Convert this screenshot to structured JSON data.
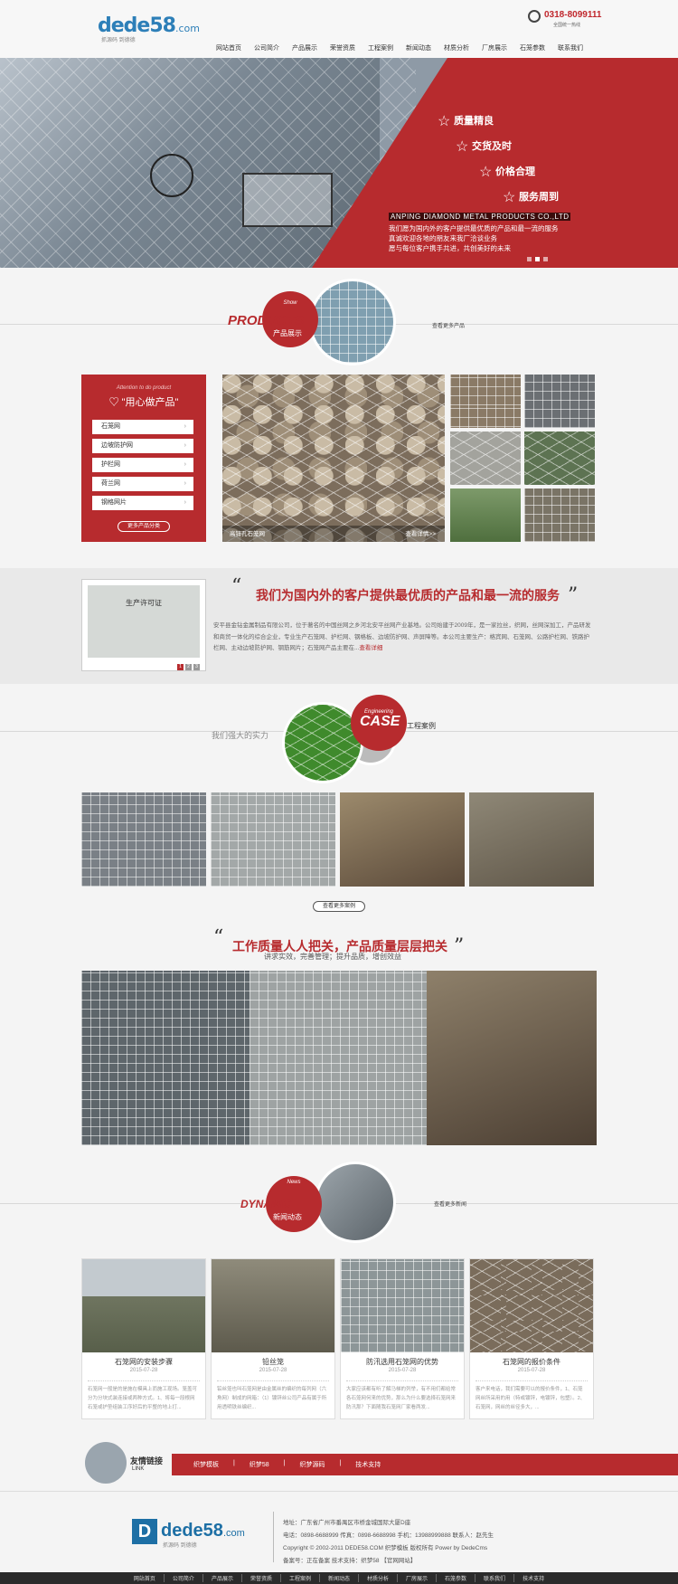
{
  "header": {
    "logo_main": "dede58",
    "logo_suffix": ".com",
    "logo_slogan": "抓源码  到德德",
    "phone": "0318-8099111",
    "phone_label": "全国统一热线"
  },
  "nav": [
    "网站首页",
    "公司简介",
    "产品展示",
    "荣誉资质",
    "工程案例",
    "新闻动态",
    "材质分析",
    "厂房展示",
    "石笼参数",
    "联系我们"
  ],
  "banner": {
    "features": [
      "质量精良",
      "交货及时",
      "价格合理",
      "服务周到"
    ],
    "company_en": "ANPING DIAMOND METAL PRODUCTS CO.,LTD",
    "text1": "我们愿为国内外的客户提供最优质的产品和最一流的服务",
    "text2": "真诚欢迎各地的朋友来我厂洽谈业务",
    "text3": "愿与每位客户携手共进，共创美好的未来",
    "slides": [
      1,
      2,
      3
    ]
  },
  "products": {
    "en": "PRODUCTS",
    "cn": "产品展示",
    "tag": "Show",
    "more": "查看更多产品",
    "side_en": "Attention to do product",
    "side_title": "\"用心做产品\"",
    "items": [
      "石笼网",
      "边坡防护网",
      "护栏网",
      "荷兰网",
      "钢格网片"
    ],
    "side_more": "更多产品分类",
    "main_caption": "高锌孔石笼网",
    "main_more": "查看详情>>"
  },
  "about": {
    "quote_open": "“",
    "quote_close": "”",
    "heading": "我们为国内外的客户提供最优质的产品和最一流的服务",
    "text": "安平县金钻金属制品有限公司，位于著名的中国丝网之乡河北安平丝网产业基地。公司始建于2009年，是一家拉丝，织网，丝网深加工，产品研发和商贸一体化的综合企业，专业生产石笼网、护栏网、钢格板、边坡防护网、声屏障等。本公司主要生产：格宾网、石笼网、公路护栏网、铁路护栏网、主动边坡防护网、钢筋网片；石笼网产品主要在...",
    "more": "查看详细",
    "cert_title": "生产许可证",
    "pages": [
      "1",
      "2",
      "3"
    ]
  },
  "cases": {
    "left_text": "我们强大的实力",
    "en": "CASE",
    "tag": "Engineering",
    "cn": "工程案例",
    "more": "查看更多案例"
  },
  "quality": {
    "heading": "工作质量人人把关，产品质量层层把关",
    "sub": "讲求实效，完善管理；提升品质，增创效益"
  },
  "news": {
    "en": "DYNAMIC",
    "tag": "News",
    "cn": "新闻动态",
    "more": "查看更多新闻",
    "items": [
      {
        "title": "石笼网的安装步骤",
        "date": "2015-07-28",
        "text": "石笼网一般是的是施在模具上而施工现场。笼盖可分为分块式装连接或两种方式。1、将每一段根网石笼或护垫组装工序好后的平整的地上打..."
      },
      {
        "title": "铅丝笼",
        "date": "2015-07-28",
        "text": "铅丝笼也叫石笼网是由金属丝的编织的每列网（六角网）制成的网箱：（1）镀锌丝公司产品有属于所用透明铁丝编织..."
      },
      {
        "title": "防汛选用石笼网的优势",
        "date": "2015-07-28",
        "text": "大家应该都有听了解马梯的列举，有不用们都给常各石笼网何来的优势，那么为什么要选择石笼网来防汛那？下面随我石笼网厂家看两发..."
      },
      {
        "title": "石笼网的报价条件",
        "date": "2015-07-28",
        "text": "客户来电话，我们需要可以的报价条件，1、石笼网丝所采用的用（特或镀锌，电镀锌，包塑）。2、石笼网，网丝的丝径多大，..."
      }
    ]
  },
  "links": {
    "title": "友情链接",
    "en": "LINK",
    "items": [
      "织梦模板",
      "|",
      "织梦58",
      "|",
      "织梦源码",
      "|",
      "技术支持"
    ]
  },
  "footer": {
    "logo": "dede58",
    "logo_suffix": ".com",
    "slogan": "抓源码  到德德",
    "address": "地址：广东省广州市番禺区市桥金城国际大厦D座",
    "contact": "电话：0898-6688999 传真：0898-6688998 手机：13988999888 联系人：赵先生",
    "copyright": "Copyright © 2002-2011 DEDE58.COM 织梦模板 版权所有 Power by DedeCms",
    "icp": "备案号：正在备案     技术支持：织梦58 【官网网站】",
    "nav": [
      "网站首页",
      "公司简介",
      "产品展示",
      "荣誉资质",
      "工程案例",
      "新闻动态",
      "材质分析",
      "厂房展示",
      "石笼参数",
      "联系我们",
      "技术支持"
    ]
  },
  "colors": {
    "accent": "#b72b2e",
    "logo_blue": "#2d7fb8"
  }
}
